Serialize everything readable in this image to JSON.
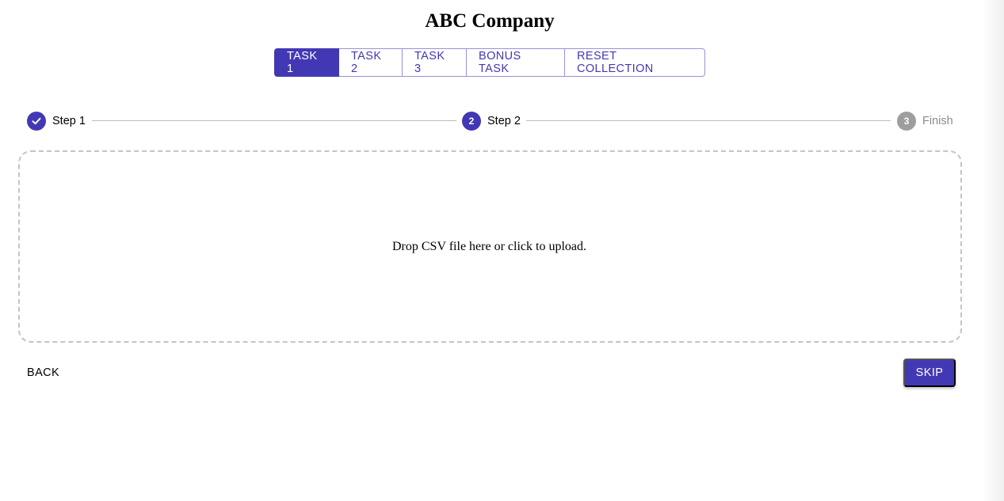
{
  "header": {
    "title": "ABC Company"
  },
  "tabs": [
    {
      "label": "TASK 1",
      "active": true
    },
    {
      "label": "TASK 2",
      "active": false
    },
    {
      "label": "TASK 3",
      "active": false
    },
    {
      "label": "BONUS TASK",
      "active": false
    },
    {
      "label": "RESET COLLECTION",
      "active": false
    }
  ],
  "stepper": {
    "steps": [
      {
        "label": "Step 1",
        "state": "completed",
        "icon": "check-icon"
      },
      {
        "label": "Step 2",
        "state": "active",
        "number": "2"
      },
      {
        "label": "Finish",
        "state": "pending",
        "number": "3"
      }
    ]
  },
  "dropzone": {
    "text": "Drop CSV file here or click to upload."
  },
  "actions": {
    "back_label": "BACK",
    "skip_label": "SKIP"
  },
  "colors": {
    "primary": "#4338b4",
    "pending": "#9e9e9e",
    "connector": "#bdbdbd",
    "dropzone_border": "#c4c4c4"
  }
}
